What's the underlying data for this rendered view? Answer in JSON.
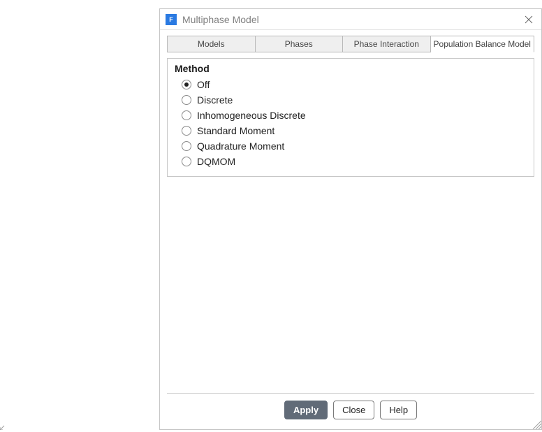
{
  "window": {
    "title": "Multiphase Model",
    "app_icon_letter": "F"
  },
  "tabs": {
    "items": [
      {
        "label": "Models",
        "active": false
      },
      {
        "label": "Phases",
        "active": false
      },
      {
        "label": "Phase Interaction",
        "active": false
      },
      {
        "label": "Population Balance Model",
        "active": true
      }
    ]
  },
  "method_group": {
    "title": "Method",
    "options": [
      {
        "label": "Off",
        "selected": true
      },
      {
        "label": "Discrete",
        "selected": false
      },
      {
        "label": "Inhomogeneous Discrete",
        "selected": false
      },
      {
        "label": "Standard Moment",
        "selected": false
      },
      {
        "label": "Quadrature Moment",
        "selected": false
      },
      {
        "label": "DQMOM",
        "selected": false
      }
    ]
  },
  "footer": {
    "apply": "Apply",
    "close": "Close",
    "help": "Help"
  }
}
